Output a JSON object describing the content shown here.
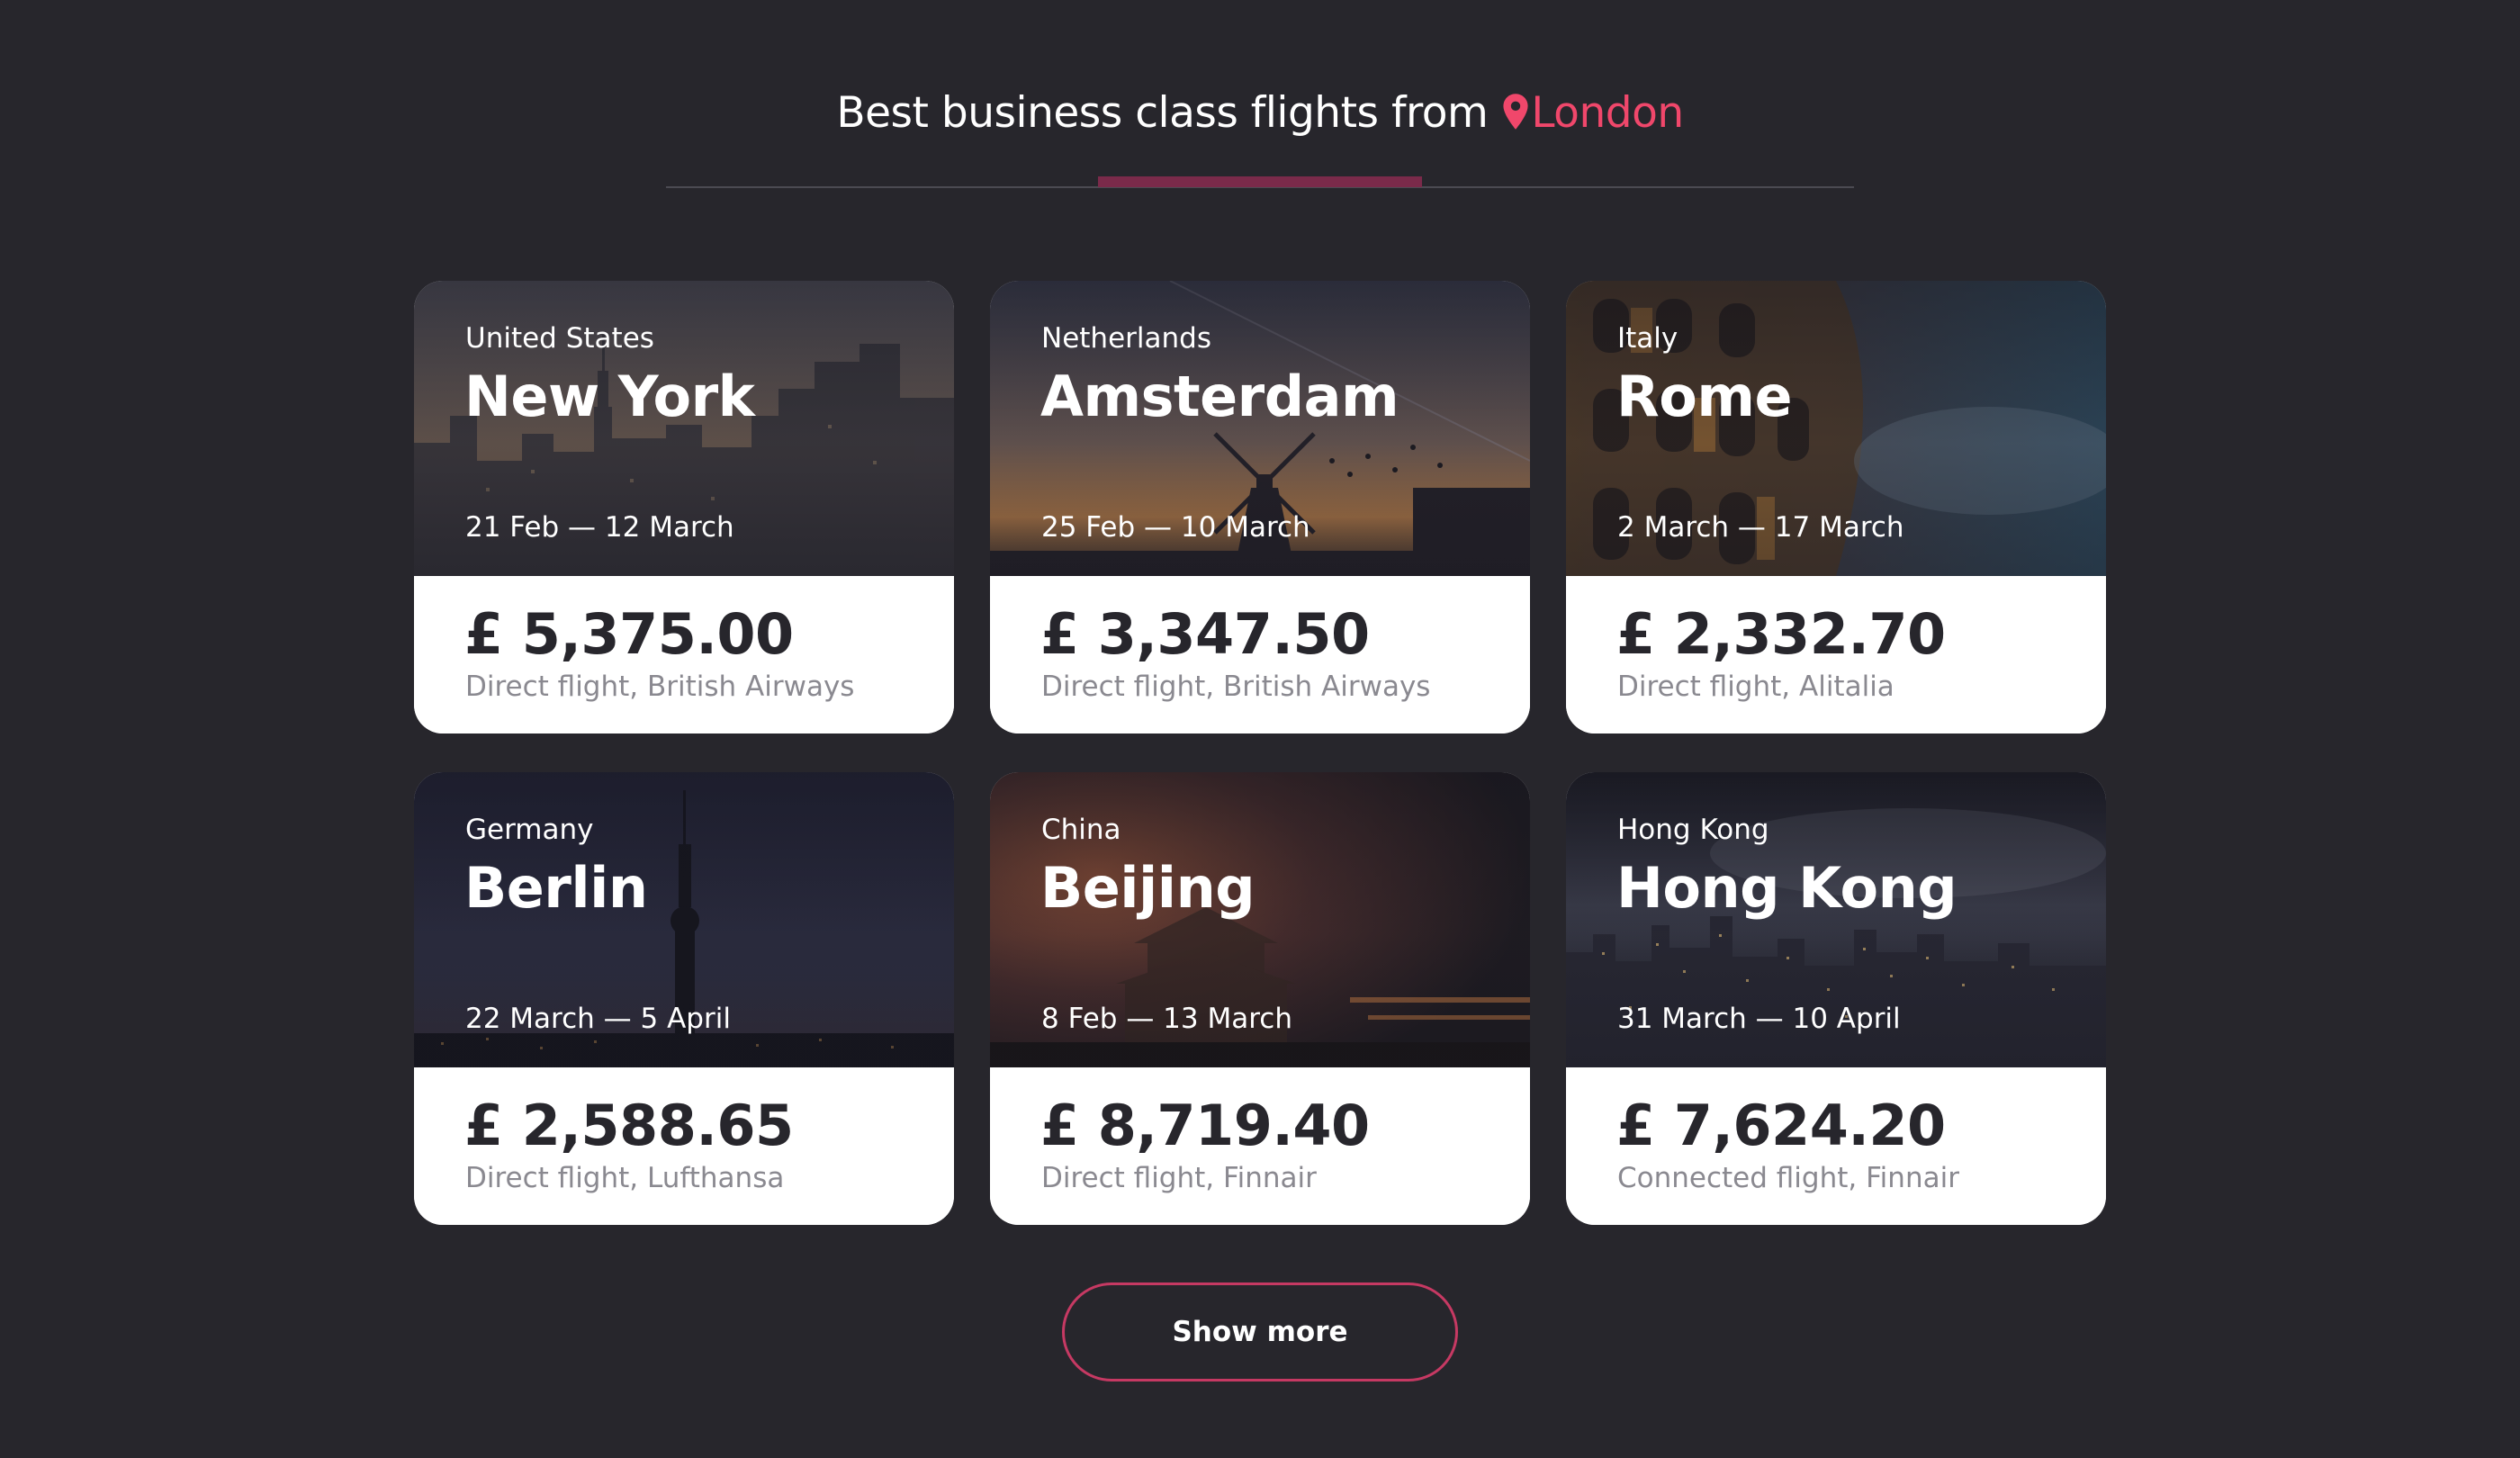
{
  "header": {
    "title": "Best business class flights from",
    "origin_city": "London",
    "accent_color": "#f0476b"
  },
  "cards": [
    {
      "country": "United States",
      "city": "New York",
      "dates": "21 Feb — 12 March",
      "price": "£ 5,375.00",
      "flight": "Direct flight, British Airways"
    },
    {
      "country": "Netherlands",
      "city": "Amsterdam",
      "dates": "25 Feb — 10 March",
      "price": "£ 3,347.50",
      "flight": "Direct flight, British Airways"
    },
    {
      "country": "Italy",
      "city": "Rome",
      "dates": "2 March — 17 March",
      "price": "£ 2,332.70",
      "flight": "Direct flight, Alitalia"
    },
    {
      "country": "Germany",
      "city": "Berlin",
      "dates": "22 March — 5 April",
      "price": "£ 2,588.65",
      "flight": "Direct flight, Lufthansa"
    },
    {
      "country": "China",
      "city": "Beijing",
      "dates": "8 Feb — 13 March",
      "price": "£ 8,719.40",
      "flight": "Direct flight, Finnair"
    },
    {
      "country": "Hong Kong",
      "city": "Hong Kong",
      "dates": "31 March — 10 April",
      "price": "£ 7,624.20",
      "flight": "Connected flight, Finnair"
    }
  ],
  "show_more_label": "Show more",
  "icons": {
    "location": "location-pin-icon"
  }
}
